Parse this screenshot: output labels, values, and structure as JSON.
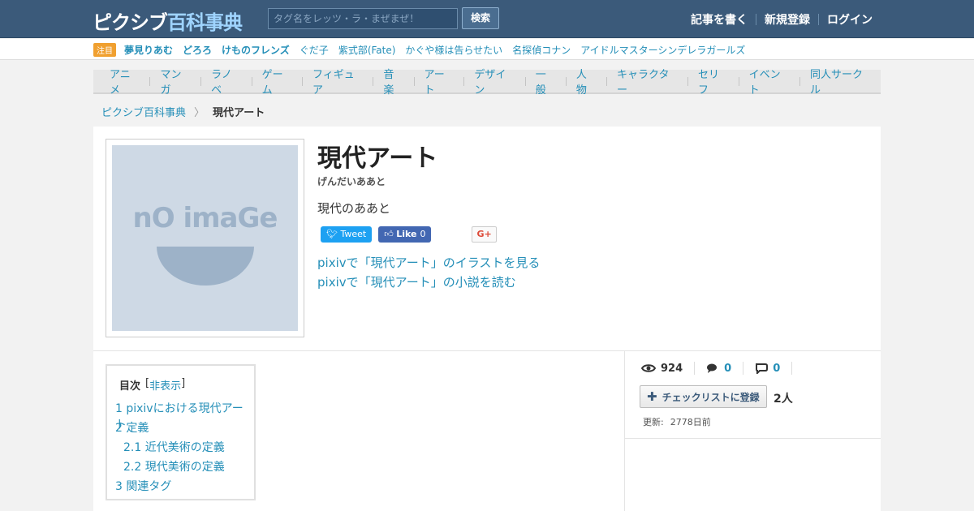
{
  "header": {
    "logo_main": "ピクシブ",
    "logo_sub": "百科事典",
    "search_placeholder": "タグ名をレッツ・ラ・まぜまぜ！",
    "search_button": "検索",
    "nav": [
      "記事を書く",
      "新規登録",
      "ログイン"
    ]
  },
  "trending": {
    "badge": "注目",
    "items": [
      "夢見りあむ",
      "どろろ",
      "けものフレンズ",
      "ぐだ子",
      "紫式部(Fate)",
      "かぐや様は告らせたい",
      "名探偵コナン",
      "アイドルマスターシンデレラガールズ"
    ]
  },
  "categories": [
    "アニメ",
    "マンガ",
    "ラノベ",
    "ゲーム",
    "フィギュア",
    "音楽",
    "アート",
    "デザイン",
    "一般",
    "人物",
    "キャラクター",
    "セリフ",
    "イベント",
    "同人サークル"
  ],
  "breadcrumb": {
    "home": "ピクシブ百科事典",
    "current": "現代アート"
  },
  "article": {
    "thumbnail_text": "nO imaGe",
    "title": "現代アート",
    "reading": "げんだいああと",
    "summary": "現代のああと",
    "share": {
      "tweet": "Tweet",
      "like": "Like",
      "like_count": "0",
      "gplus": "G+"
    },
    "links": [
      "pixivで「現代アート」のイラストを見る",
      "pixivで「現代アート」の小説を読む"
    ]
  },
  "toc": {
    "title": "目次",
    "toggle": "非表示",
    "items": [
      "1 pixivにおける現代アート",
      "2 定義",
      "2.1 近代美術の定義",
      "2.2 現代美術の定義",
      "3 関連タグ"
    ]
  },
  "stats": {
    "views": "924",
    "comments": "0",
    "pins": "0",
    "checklist_button": "チェックリストに登録",
    "checklist_count": "2人",
    "updated_label": "更新:",
    "updated_value": "2778日前"
  },
  "icons": [
    "eye-icon",
    "comments-icon",
    "pin-icon",
    "plus-icon",
    "twitter-icon",
    "facebook-like-icon"
  ],
  "colors": {
    "header_bg": "#3b5a7a",
    "link": "#258fb8",
    "twitter": "#1da1f2",
    "facebook": "#4267b2",
    "badge": "#f0a030"
  }
}
